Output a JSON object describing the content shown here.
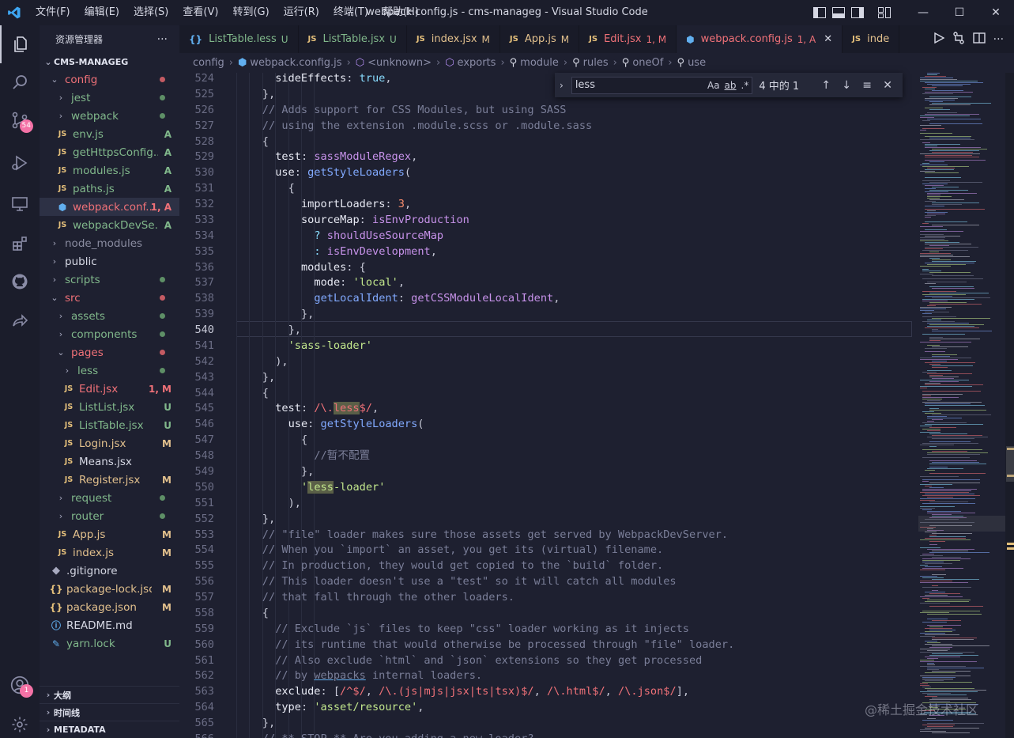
{
  "window": {
    "title": "webpack.config.js - cms-manageg - Visual Studio Code",
    "menu": [
      "文件(F)",
      "编辑(E)",
      "选择(S)",
      "查看(V)",
      "转到(G)",
      "运行(R)",
      "终端(T)",
      "帮助(H)"
    ]
  },
  "activity_bar": {
    "scm_badge": "54",
    "account_badge": "1",
    "icons": [
      "explorer-icon",
      "search-icon",
      "source-control-icon",
      "run-debug-icon",
      "remote-explorer-icon",
      "extensions-icon",
      "github-icon",
      "live-share-icon"
    ]
  },
  "sidebar": {
    "header": "资源管理器",
    "more": "···",
    "root": "CMS-MANAGEG",
    "tree": [
      {
        "label": "config",
        "kind": "folder-open",
        "indent": 1,
        "color": "err",
        "status": "",
        "dot": "#c45b63"
      },
      {
        "label": "jest",
        "kind": "folder",
        "indent": 2,
        "color": "add",
        "status": "",
        "dot": "#5e8f66"
      },
      {
        "label": "webpack",
        "kind": "folder",
        "indent": 2,
        "color": "add",
        "status": "",
        "dot": "#5e8f66"
      },
      {
        "label": "env.js",
        "kind": "js",
        "indent": 2,
        "color": "add",
        "status": "A"
      },
      {
        "label": "getHttpsConfig...",
        "kind": "js",
        "indent": 2,
        "color": "add",
        "status": "A"
      },
      {
        "label": "modules.js",
        "kind": "js",
        "indent": 2,
        "color": "add",
        "status": "A"
      },
      {
        "label": "paths.js",
        "kind": "js",
        "indent": 2,
        "color": "add",
        "status": "A"
      },
      {
        "label": "webpack.conf...",
        "kind": "cfg",
        "indent": 2,
        "color": "err",
        "status": "1, A",
        "selected": true
      },
      {
        "label": "webpackDevSe...",
        "kind": "js",
        "indent": 2,
        "color": "add",
        "status": "A"
      },
      {
        "label": "node_modules",
        "kind": "folder",
        "indent": 1,
        "color": "dim",
        "status": ""
      },
      {
        "label": "public",
        "kind": "folder",
        "indent": 1,
        "color": "norm",
        "status": ""
      },
      {
        "label": "scripts",
        "kind": "folder",
        "indent": 1,
        "color": "add",
        "status": "",
        "dot": "#5e8f66"
      },
      {
        "label": "src",
        "kind": "folder-open",
        "indent": 1,
        "color": "err",
        "status": "",
        "dot": "#c45b63"
      },
      {
        "label": "assets",
        "kind": "folder",
        "indent": 2,
        "color": "add",
        "status": "",
        "dot": "#5e8f66"
      },
      {
        "label": "components",
        "kind": "folder",
        "indent": 2,
        "color": "add",
        "status": "",
        "dot": "#5e8f66"
      },
      {
        "label": "pages",
        "kind": "folder-open",
        "indent": 2,
        "color": "err",
        "status": "",
        "dot": "#c45b63"
      },
      {
        "label": "less",
        "kind": "folder",
        "indent": 3,
        "color": "add",
        "status": "",
        "dot": "#5e8f66"
      },
      {
        "label": "Edit.jsx",
        "kind": "js",
        "indent": 3,
        "color": "err",
        "status": "1, M"
      },
      {
        "label": "ListList.jsx",
        "kind": "js",
        "indent": 3,
        "color": "add",
        "status": "U"
      },
      {
        "label": "ListTable.jsx",
        "kind": "js",
        "indent": 3,
        "color": "add",
        "status": "U"
      },
      {
        "label": "Login.jsx",
        "kind": "js",
        "indent": 3,
        "color": "mod",
        "status": "M"
      },
      {
        "label": "Means.jsx",
        "kind": "js",
        "indent": 3,
        "color": "norm",
        "status": ""
      },
      {
        "label": "Register.jsx",
        "kind": "js",
        "indent": 3,
        "color": "mod",
        "status": "M"
      },
      {
        "label": "request",
        "kind": "folder",
        "indent": 2,
        "color": "add",
        "status": "",
        "dot": "#5e8f66"
      },
      {
        "label": "router",
        "kind": "folder",
        "indent": 2,
        "color": "add",
        "status": "",
        "dot": "#5e8f66"
      },
      {
        "label": "App.js",
        "kind": "js",
        "indent": 2,
        "color": "mod",
        "status": "M"
      },
      {
        "label": "index.js",
        "kind": "js",
        "indent": 2,
        "color": "mod",
        "status": "M"
      },
      {
        "label": ".gitignore",
        "kind": "dot",
        "indent": 1,
        "color": "norm",
        "status": ""
      },
      {
        "label": "package-lock.json",
        "kind": "json",
        "indent": 1,
        "color": "mod",
        "status": "M"
      },
      {
        "label": "package.json",
        "kind": "json",
        "indent": 1,
        "color": "mod",
        "status": "M"
      },
      {
        "label": "README.md",
        "kind": "info",
        "indent": 1,
        "color": "norm",
        "status": ""
      },
      {
        "label": "yarn.lock",
        "kind": "yarn",
        "indent": 1,
        "color": "add",
        "status": "U"
      }
    ],
    "bottom_sections": [
      "大纲",
      "时间线",
      "METADATA"
    ]
  },
  "tabs": [
    {
      "icon": "{}",
      "label": "ListTable.less",
      "status": "U",
      "color": "add"
    },
    {
      "icon": "JS",
      "label": "ListTable.jsx",
      "status": "U",
      "color": "add"
    },
    {
      "icon": "JS",
      "label": "index.jsx",
      "status": "M",
      "color": "mod"
    },
    {
      "icon": "JS",
      "label": "App.js",
      "status": "M",
      "color": "mod"
    },
    {
      "icon": "JS",
      "label": "Edit.jsx",
      "status": "1, M",
      "color": "err"
    },
    {
      "icon": "cfg",
      "label": "webpack.config.js",
      "status": "1, A",
      "color": "err",
      "active": true
    },
    {
      "icon": "JS",
      "label": "inde",
      "status": "",
      "color": "mod"
    }
  ],
  "breadcrumb": [
    "config",
    "webpack.config.js",
    "<unknown>",
    "exports",
    "module",
    "rules",
    "oneOf",
    "use"
  ],
  "find": {
    "query": "less",
    "count": "4 中的 1",
    "options": [
      "Aa",
      "ab",
      ".*"
    ]
  },
  "editor": {
    "current_line": 540,
    "lines": [
      {
        "n": 524,
        "indent": 4,
        "html": "<span class='t-key'>sideEffects</span>: <span class='t-kw'>true</span>,"
      },
      {
        "n": 525,
        "indent": 3,
        "html": "},"
      },
      {
        "n": 526,
        "indent": 3,
        "html": "<span class='t-com'>// Adds support for CSS Modules, but using SASS</span>"
      },
      {
        "n": 527,
        "indent": 3,
        "html": "<span class='t-com'>// using the extension .module.scss or .module.sass</span>"
      },
      {
        "n": 528,
        "indent": 3,
        "html": "{"
      },
      {
        "n": 529,
        "indent": 4,
        "html": "<span class='t-key'>test</span>: <span class='t-var'>sassModuleRegex</span>,"
      },
      {
        "n": 530,
        "indent": 4,
        "html": "<span class='t-key'>use</span>: <span class='t-fn'>getStyleLoaders</span>("
      },
      {
        "n": 531,
        "indent": 5,
        "html": "{"
      },
      {
        "n": 532,
        "indent": 6,
        "html": "<span class='t-key'>importLoaders</span>: <span class='t-num'>3</span>,"
      },
      {
        "n": 533,
        "indent": 6,
        "html": "<span class='t-key'>sourceMap</span>: <span class='t-var'>isEnvProduction</span>"
      },
      {
        "n": 534,
        "indent": 7,
        "html": "<span class='t-kw'>?</span> <span class='t-var'>shouldUseSourceMap</span>"
      },
      {
        "n": 535,
        "indent": 7,
        "html": "<span class='t-kw'>:</span> <span class='t-var'>isEnvDevelopment</span>,"
      },
      {
        "n": 536,
        "indent": 6,
        "html": "<span class='t-key'>modules</span>: {"
      },
      {
        "n": 537,
        "indent": 7,
        "html": "<span class='t-key'>mode</span>: <span class='t-str'>'local'</span>,"
      },
      {
        "n": 538,
        "indent": 7,
        "html": "<span class='t-fn'>getLocalIdent</span>: <span class='t-var'>getCSSModuleLocalIdent</span>,"
      },
      {
        "n": 539,
        "indent": 6,
        "html": "},"
      },
      {
        "n": 540,
        "indent": 5,
        "html": "},"
      },
      {
        "n": 541,
        "indent": 5,
        "html": "<span class='t-str'>'sass-loader'</span>"
      },
      {
        "n": 542,
        "indent": 4,
        "html": "),"
      },
      {
        "n": 543,
        "indent": 3,
        "html": "},"
      },
      {
        "n": 544,
        "indent": 3,
        "html": "{"
      },
      {
        "n": 545,
        "indent": 4,
        "html": "<span class='t-key'>test</span>: <span class='t-re'>/\\.<span class='hl'>less</span>$/</span>,"
      },
      {
        "n": 546,
        "indent": 5,
        "html": "<span class='t-key'>use</span>: <span class='t-fn'>getStyleLoaders</span>("
      },
      {
        "n": 547,
        "indent": 6,
        "html": "{"
      },
      {
        "n": 548,
        "indent": 7,
        "html": "<span class='t-com'>//暂不配置</span>"
      },
      {
        "n": 549,
        "indent": 6,
        "html": "},"
      },
      {
        "n": 550,
        "indent": 6,
        "html": "<span class='t-str'>'<span class='hl'>less</span>-loader'</span>"
      },
      {
        "n": 551,
        "indent": 5,
        "html": "),"
      },
      {
        "n": 552,
        "indent": 3,
        "html": "},"
      },
      {
        "n": 553,
        "indent": 3,
        "html": "<span class='t-com'>// \"file\" loader makes sure those assets get served by WebpackDevServer.</span>"
      },
      {
        "n": 554,
        "indent": 3,
        "html": "<span class='t-com'>// When you `import` an asset, you get its (virtual) filename.</span>"
      },
      {
        "n": 555,
        "indent": 3,
        "html": "<span class='t-com'>// In production, they would get copied to the `build` folder.</span>"
      },
      {
        "n": 556,
        "indent": 3,
        "html": "<span class='t-com'>// This loader doesn't use a \"test\" so it will catch all modules</span>"
      },
      {
        "n": 557,
        "indent": 3,
        "html": "<span class='t-com'>// that fall through the other loaders.</span>"
      },
      {
        "n": 558,
        "indent": 3,
        "html": "{"
      },
      {
        "n": 559,
        "indent": 4,
        "html": "<span class='t-com'>// Exclude `js` files to keep \"css\" loader working as it injects</span>"
      },
      {
        "n": 560,
        "indent": 4,
        "html": "<span class='t-com'>// its runtime that would otherwise be processed through \"file\" loader.</span>"
      },
      {
        "n": 561,
        "indent": 4,
        "html": "<span class='t-com'>// Also exclude `html` and `json` extensions so they get processed</span>"
      },
      {
        "n": 562,
        "indent": 4,
        "html": "<span class='t-com'>// by <u style='text-decoration-color:#61afef'>webpacks</u> internal loaders.</span>"
      },
      {
        "n": 563,
        "indent": 4,
        "html": "<span class='t-key'>exclude</span>: [<span class='t-re'>/^$/</span>, <span class='t-re'>/\\.(js|mjs|jsx|ts|tsx)$/</span>, <span class='t-re'>/\\.html$/</span>, <span class='t-re'>/\\.json$/</span>],"
      },
      {
        "n": 564,
        "indent": 4,
        "html": "<span class='t-key'>type</span>: <span class='t-str'>'asset/resource'</span>,"
      },
      {
        "n": 565,
        "indent": 3,
        "html": "},"
      },
      {
        "n": 566,
        "indent": 3,
        "html": "<span class='t-com'>// ** STOP ** Are you adding a new loader?</span>"
      }
    ]
  },
  "watermark": "@稀土掘金技术社区",
  "colors": {
    "accent_red": "#f07178",
    "added_green": "#81b88b",
    "modified_gold": "#e2c08d",
    "badge_pink": "#f472a6",
    "background": "#1e2030"
  }
}
